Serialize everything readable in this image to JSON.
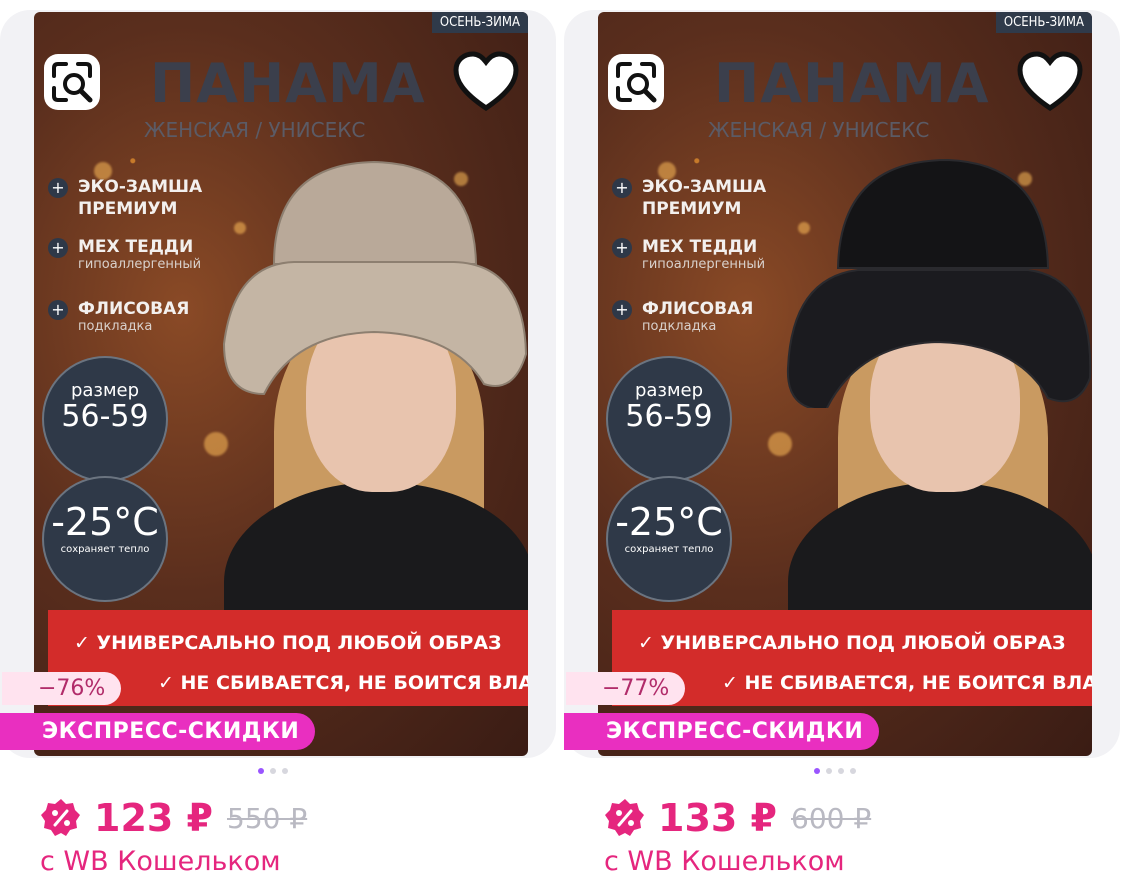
{
  "cards": [
    {
      "season": "ОСЕНЬ-ЗИМА",
      "title": "ПАНАМА",
      "subtitle": "ЖЕНСКАЯ / УНИСЕКС",
      "features": [
        {
          "t1": "ЭКО-ЗАМША",
          "t1b": "ПРЕМИУМ",
          "t2": ""
        },
        {
          "t1": "МЕХ ТЕДДИ",
          "t1b": "",
          "t2": "гипоаллергенный"
        },
        {
          "t1": "ФЛИСОВАЯ",
          "t1b": "",
          "t2": "подкладка"
        }
      ],
      "size_label": "размер",
      "size_value": "56-59",
      "temp_value": "-25°C",
      "temp_note": "сохраняет тепло",
      "banner_line1": "✓ УНИВЕРСАЛЬНО ПОД ЛЮБОЙ ОБРАЗ",
      "banner_line2": "✓ НЕ СБИВАЕТСЯ, НЕ БОИТСЯ ВЛАГИ",
      "discount": "−76%",
      "express": "ЭКСПРЕСС-СКИДКИ",
      "price": "123 ₽",
      "old_price": "550 ₽",
      "wallet": "с WB Кошельком",
      "hat_color": "#b9a999",
      "dots_total": 3,
      "dots_active": 0
    },
    {
      "season": "ОСЕНЬ-ЗИМА",
      "title": "ПАНАМА",
      "subtitle": "ЖЕНСКАЯ / УНИСЕКС",
      "features": [
        {
          "t1": "ЭКО-ЗАМША",
          "t1b": "ПРЕМИУМ",
          "t2": ""
        },
        {
          "t1": "МЕХ ТЕДДИ",
          "t1b": "",
          "t2": "гипоаллергенный"
        },
        {
          "t1": "ФЛИСОВАЯ",
          "t1b": "",
          "t2": "подкладка"
        }
      ],
      "size_label": "размер",
      "size_value": "56-59",
      "temp_value": "-25°C",
      "temp_note": "сохраняет тепло",
      "banner_line1": "✓ УНИВЕРСАЛЬНО ПОД ЛЮБОЙ ОБРАЗ",
      "banner_line2": "✓ НЕ СБИВАЕТСЯ, НЕ БОИТСЯ ВЛАГИ",
      "discount": "−77%",
      "express": "ЭКСПРЕСС-СКИДКИ",
      "price": "133 ₽",
      "old_price": "600 ₽",
      "wallet": "с WB Кошельком",
      "hat_color": "#141416",
      "dots_total": 4,
      "dots_active": 0
    }
  ],
  "colors": {
    "price": "#e5267e",
    "express_bg": "#e92fc0",
    "discount_bg": "#ffe3ef",
    "banner_red": "#d32c2a",
    "dot_active": "#9a55ff"
  },
  "icons": [
    "search-similar-icon",
    "heart-icon",
    "wallet-discount-icon"
  ]
}
